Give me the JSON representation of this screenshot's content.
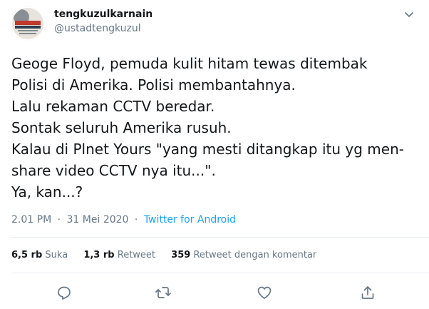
{
  "user": {
    "display_name": "tengkuzulkarnain",
    "handle": "@ustadtengkuzul"
  },
  "tweet": {
    "lines": [
      "Geoge Floyd, pemuda kulit hitam tewas ditembak",
      "Polisi di Amerika. Polisi membantahnya.",
      "Lalu rekaman CCTV beredar.",
      "Sontak seluruh Amerika rusuh.",
      "Kalau di Plnet Yours \"yang mesti ditangkap itu yg men-",
      "share video CCTV nya itu...\".",
      "Ya, kan...?"
    ],
    "time": "2.01 PM",
    "date": "31 Mei 2020",
    "separator": "·",
    "source": "Twitter for Android"
  },
  "stats": {
    "likes": {
      "count": "6,5 rb",
      "label": "Suka"
    },
    "retweets": {
      "count": "1,3 rb",
      "label": "Retweet"
    },
    "quotes": {
      "count": "359",
      "label": "Retweet dengan komentar"
    }
  },
  "icons": {
    "menu": "chevron-down-icon",
    "reply": "reply-icon",
    "retweet": "retweet-icon",
    "like": "like-icon",
    "share": "share-icon"
  },
  "colors": {
    "text": "#14171a",
    "secondary": "#657786",
    "link": "#1da1f2",
    "divider": "#e6ecf0"
  }
}
